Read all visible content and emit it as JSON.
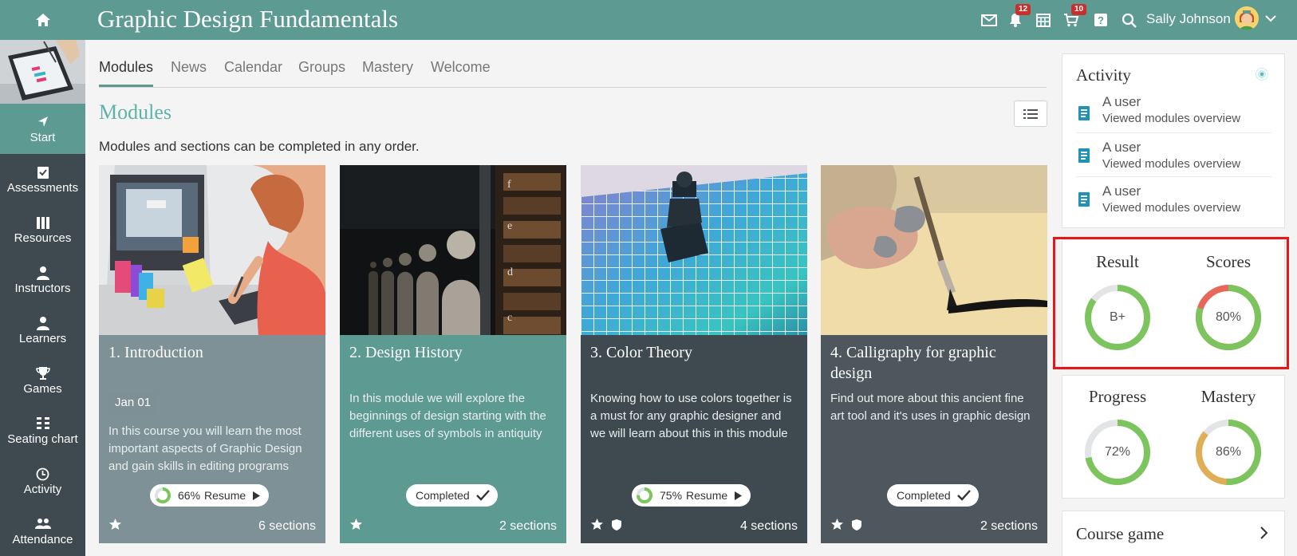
{
  "header": {
    "course_title": "Graphic Design Fundamentals",
    "notifications_count": "12",
    "cart_count": "10",
    "user_name": "Sally Johnson"
  },
  "sidebar": {
    "items": [
      {
        "label": "Start",
        "icon": "navigation-arrow-icon"
      },
      {
        "label": "Assessments",
        "icon": "clipboard-check-icon"
      },
      {
        "label": "Resources",
        "icon": "books-icon"
      },
      {
        "label": "Instructors",
        "icon": "person-icon"
      },
      {
        "label": "Learners",
        "icon": "person-icon"
      },
      {
        "label": "Games",
        "icon": "trophy-icon"
      },
      {
        "label": "Seating chart",
        "icon": "seating-chart-icon"
      },
      {
        "label": "Activity",
        "icon": "clock-icon"
      },
      {
        "label": "Attendance",
        "icon": "group-icon"
      }
    ]
  },
  "tabs": [
    "Modules",
    "News",
    "Calendar",
    "Groups",
    "Mastery",
    "Welcome"
  ],
  "main": {
    "heading": "Modules",
    "description": "Modules and sections can be completed in any order."
  },
  "modules": [
    {
      "title": "1. Introduction",
      "date": "Jan 01",
      "text": "In this course you will learn the most important aspects of Graphic Design and gain skills in editing programs",
      "progress_label": "66%",
      "progress": 0.66,
      "action": "Resume",
      "sections": "6 sections"
    },
    {
      "title": "2. Design History",
      "text": "In this module we will explore the beginnings of design starting with the different uses of symbols in antiquity",
      "status": "Completed",
      "sections": "2 sections"
    },
    {
      "title": "3. Color Theory",
      "text": "Knowing how to use colors together is a must for any graphic designer and we will learn about this in this module",
      "progress_label": "75%",
      "progress": 0.75,
      "action": "Resume",
      "sections": "4 sections"
    },
    {
      "title": "4. Calligraphy for graphic design",
      "text": "Find out more about this ancient fine art tool and it's uses in graphic design",
      "status": "Completed",
      "sections": "2 sections"
    }
  ],
  "activity": {
    "title": "Activity",
    "items": [
      {
        "user": "A user",
        "action": "Viewed modules overview"
      },
      {
        "user": "A user",
        "action": "Viewed modules overview"
      },
      {
        "user": "A user",
        "action": "Viewed modules overview"
      }
    ]
  },
  "gauges": {
    "result": {
      "label": "Result",
      "value": "B+",
      "fraction": 0.85
    },
    "scores": {
      "label": "Scores",
      "value": "80%",
      "fraction": 0.8
    },
    "progress": {
      "label": "Progress",
      "value": "72%",
      "fraction": 0.72
    },
    "mastery": {
      "label": "Mastery",
      "value": "86%",
      "fraction": 0.86
    }
  },
  "course_game": {
    "title": "Course game"
  },
  "colors": {
    "brand": "#5c9a92",
    "sidebar": "#3e4a4f",
    "gauge_green": "#7cc45d",
    "gauge_red": "#e8665a",
    "gauge_orange": "#dfae55",
    "highlight": "#e8151b"
  }
}
